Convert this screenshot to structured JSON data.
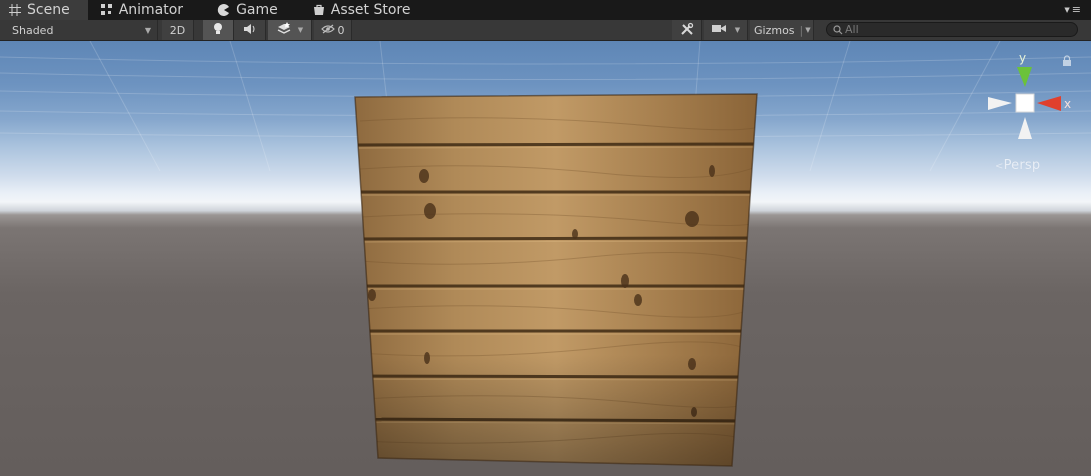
{
  "tabs": [
    {
      "label": "Scene",
      "icon": "scene-grid-icon",
      "active": true
    },
    {
      "label": "Animator",
      "icon": "animator-icon",
      "active": false
    },
    {
      "label": "Game",
      "icon": "game-pacman-icon",
      "active": false
    },
    {
      "label": "Asset Store",
      "icon": "asset-store-icon",
      "active": false
    }
  ],
  "toolbar": {
    "draw_mode": "Shaded",
    "mode_2d": "2D",
    "hidden_count": "0",
    "gizmos_label": "Gizmos",
    "search_placeholder": "All"
  },
  "scene": {
    "camera_projection": "Persp",
    "gizmo_axes": {
      "y": "y",
      "x": "x"
    },
    "object": "wooden plank crate"
  },
  "colors": {
    "sky_top": "#5e86b6",
    "horizon": "#f2f5f8",
    "ground": "#6b6563",
    "axis_x": "#e0402e",
    "axis_y": "#6bc23a",
    "wood": "#a8804f"
  }
}
